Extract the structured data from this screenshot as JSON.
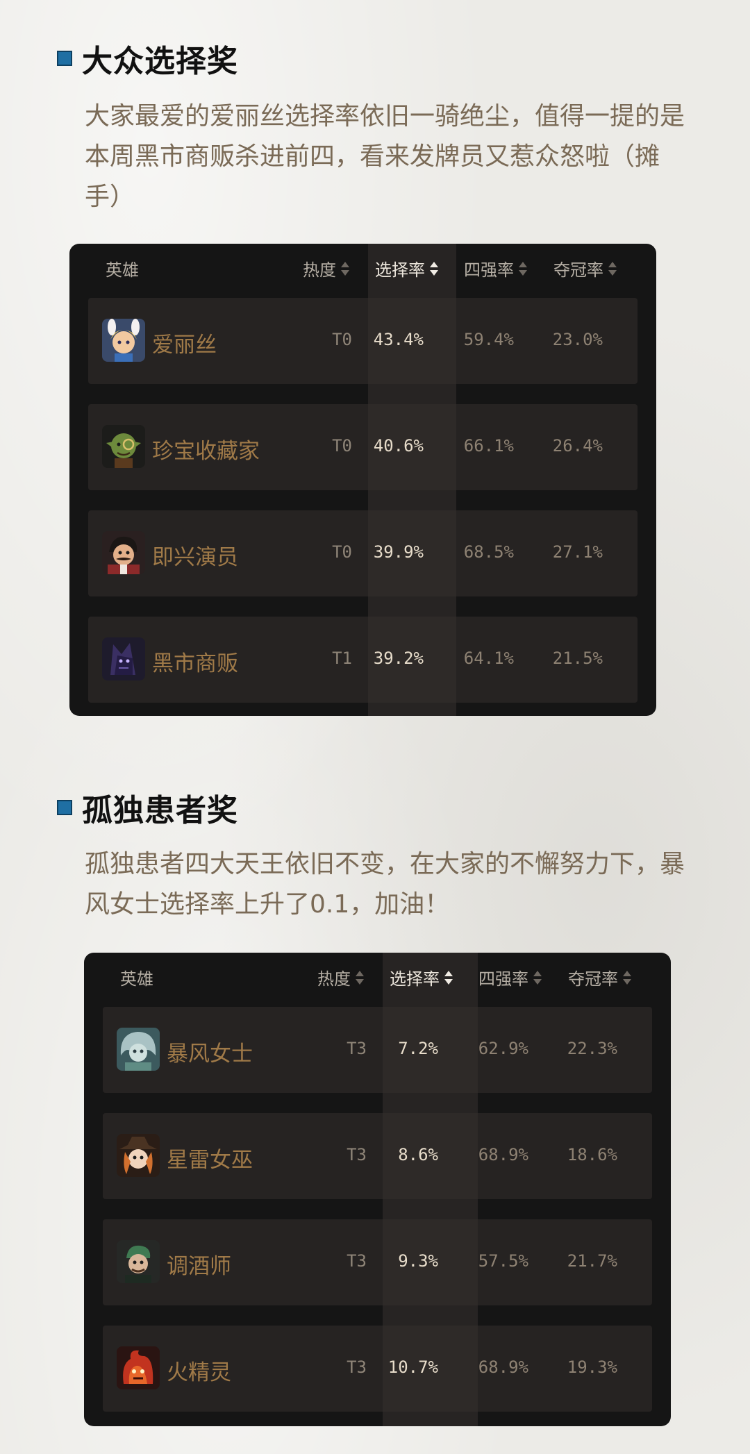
{
  "sections": [
    {
      "title": "大众选择奖",
      "paragraph": "大家最爱的爱丽丝选择率依旧一骑绝尘，值得一提的是本周黑市商贩杀进前四，看来发牌员又惹众怒啦（摊手）",
      "table": {
        "headers": {
          "hero": "英雄",
          "heat": "热度",
          "pick": "选择率",
          "top4": "四强率",
          "win": "夺冠率"
        },
        "sorted_column": "pick",
        "rows": [
          {
            "avatar": "alice-avatar-icon",
            "name": "爱丽丝",
            "tier": "T0",
            "pick": "43.4%",
            "top4": "59.4%",
            "win": "23.0%"
          },
          {
            "avatar": "collector-avatar-icon",
            "name": "珍宝收藏家",
            "tier": "T0",
            "pick": "40.6%",
            "top4": "66.1%",
            "win": "26.4%"
          },
          {
            "avatar": "improviser-avatar-icon",
            "name": "即兴演员",
            "tier": "T0",
            "pick": "39.9%",
            "top4": "68.5%",
            "win": "27.1%"
          },
          {
            "avatar": "black-market-avatar-icon",
            "name": "黑市商贩",
            "tier": "T1",
            "pick": "39.2%",
            "top4": "64.1%",
            "win": "21.5%"
          }
        ]
      }
    },
    {
      "title": "孤独患者奖",
      "paragraph": "孤独患者四大天王依旧不变，在大家的不懈努力下，暴风女士选择率上升了0.1，加油！",
      "table": {
        "headers": {
          "hero": "英雄",
          "heat": "热度",
          "pick": "选择率",
          "top4": "四强率",
          "win": "夺冠率"
        },
        "sorted_column": "pick",
        "rows": [
          {
            "avatar": "storm-lady-avatar-icon",
            "name": "暴风女士",
            "tier": "T3",
            "pick": "7.2%",
            "top4": "62.9%",
            "win": "22.3%"
          },
          {
            "avatar": "thunder-witch-avatar-icon",
            "name": "星雷女巫",
            "tier": "T3",
            "pick": "8.6%",
            "top4": "68.9%",
            "win": "18.6%"
          },
          {
            "avatar": "bartender-avatar-icon",
            "name": "调酒师",
            "tier": "T3",
            "pick": "9.3%",
            "top4": "57.5%",
            "win": "21.7%"
          },
          {
            "avatar": "fire-spirit-avatar-icon",
            "name": "火精灵",
            "tier": "T3",
            "pick": "10.7%",
            "top4": "68.9%",
            "win": "19.3%"
          }
        ]
      }
    }
  ],
  "colors": {
    "accent_square": "#1f6fa3",
    "hero_name": "#a07a48",
    "panel_bg": "#151515"
  }
}
